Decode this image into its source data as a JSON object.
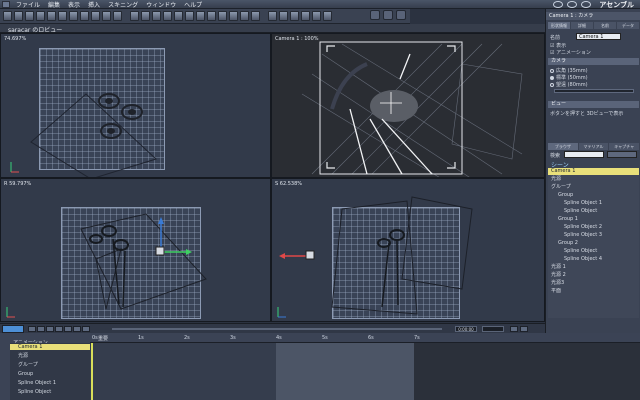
{
  "menubar": {
    "items": [
      "ファイル",
      "編集",
      "表示",
      "挿入",
      "スキニング",
      "ウィンドウ",
      "ヘルプ"
    ],
    "mode_label": "アセンブル"
  },
  "viewports": {
    "header_title": "saracar のロビュー",
    "top_left": "74.697%",
    "top_right": "Camera 1 : 100%",
    "bottom_left": "R 59.797%",
    "bottom_right": "S 62.538%"
  },
  "panel": {
    "title": "Camera 1 : カメラ",
    "tabs": [
      "形状情報",
      "詳細",
      "名前",
      "データ"
    ],
    "name_label": "名前",
    "name_value": "Camera 1",
    "visible_label": "表示",
    "animation_label": "アニメーション",
    "camera_section": "カメラ",
    "lens_options": [
      "広角 (35mm)",
      "標準 (50mm)",
      "望遠 (80mm)"
    ],
    "view_section": "ビュー",
    "view_note": "ボタンを押すと 3Dビューで表示",
    "browser_tabs": [
      "ブラウザ",
      "マテリアル",
      "キャプチャ"
    ],
    "search_label": "検索",
    "scene_title": "シーン",
    "tree": [
      {
        "label": "Camera 1",
        "selected": true
      },
      {
        "label": "光源",
        "selected": false
      },
      {
        "label": "グループ",
        "selected": false
      },
      {
        "label": "Group",
        "selected": false
      },
      {
        "label": "Spline Object 1",
        "selected": false
      },
      {
        "label": "Spline Object",
        "selected": false
      },
      {
        "label": "Group 1",
        "selected": false
      },
      {
        "label": "Spline Object 2",
        "selected": false
      },
      {
        "label": "Spline Object 3",
        "selected": false
      },
      {
        "label": "Group 2",
        "selected": false
      },
      {
        "label": "Spline Object",
        "selected": false
      },
      {
        "label": "Spline Object 4",
        "selected": false
      },
      {
        "label": "光源 1",
        "selected": false
      },
      {
        "label": "光源 2",
        "selected": false
      },
      {
        "label": "光源3",
        "selected": false
      },
      {
        "label": "平面",
        "selected": false
      }
    ]
  },
  "timeline": {
    "tree_title": "アニメーション",
    "rows": [
      "Camera 1",
      "光源",
      "グループ",
      "Group",
      "Spline Object 1",
      "Spline Object"
    ],
    "ruler_label": "重要",
    "ticks": [
      "0s",
      "1s",
      "2s",
      "3s",
      "4s",
      "5s",
      "6s",
      "7s"
    ],
    "frame_value": "0:00:00"
  },
  "colors": {
    "selected_row": "#e9e07a",
    "viewport_bg": "#323a4a",
    "camera_bg": "#2a2d33",
    "panel_bg": "#3a4253"
  }
}
